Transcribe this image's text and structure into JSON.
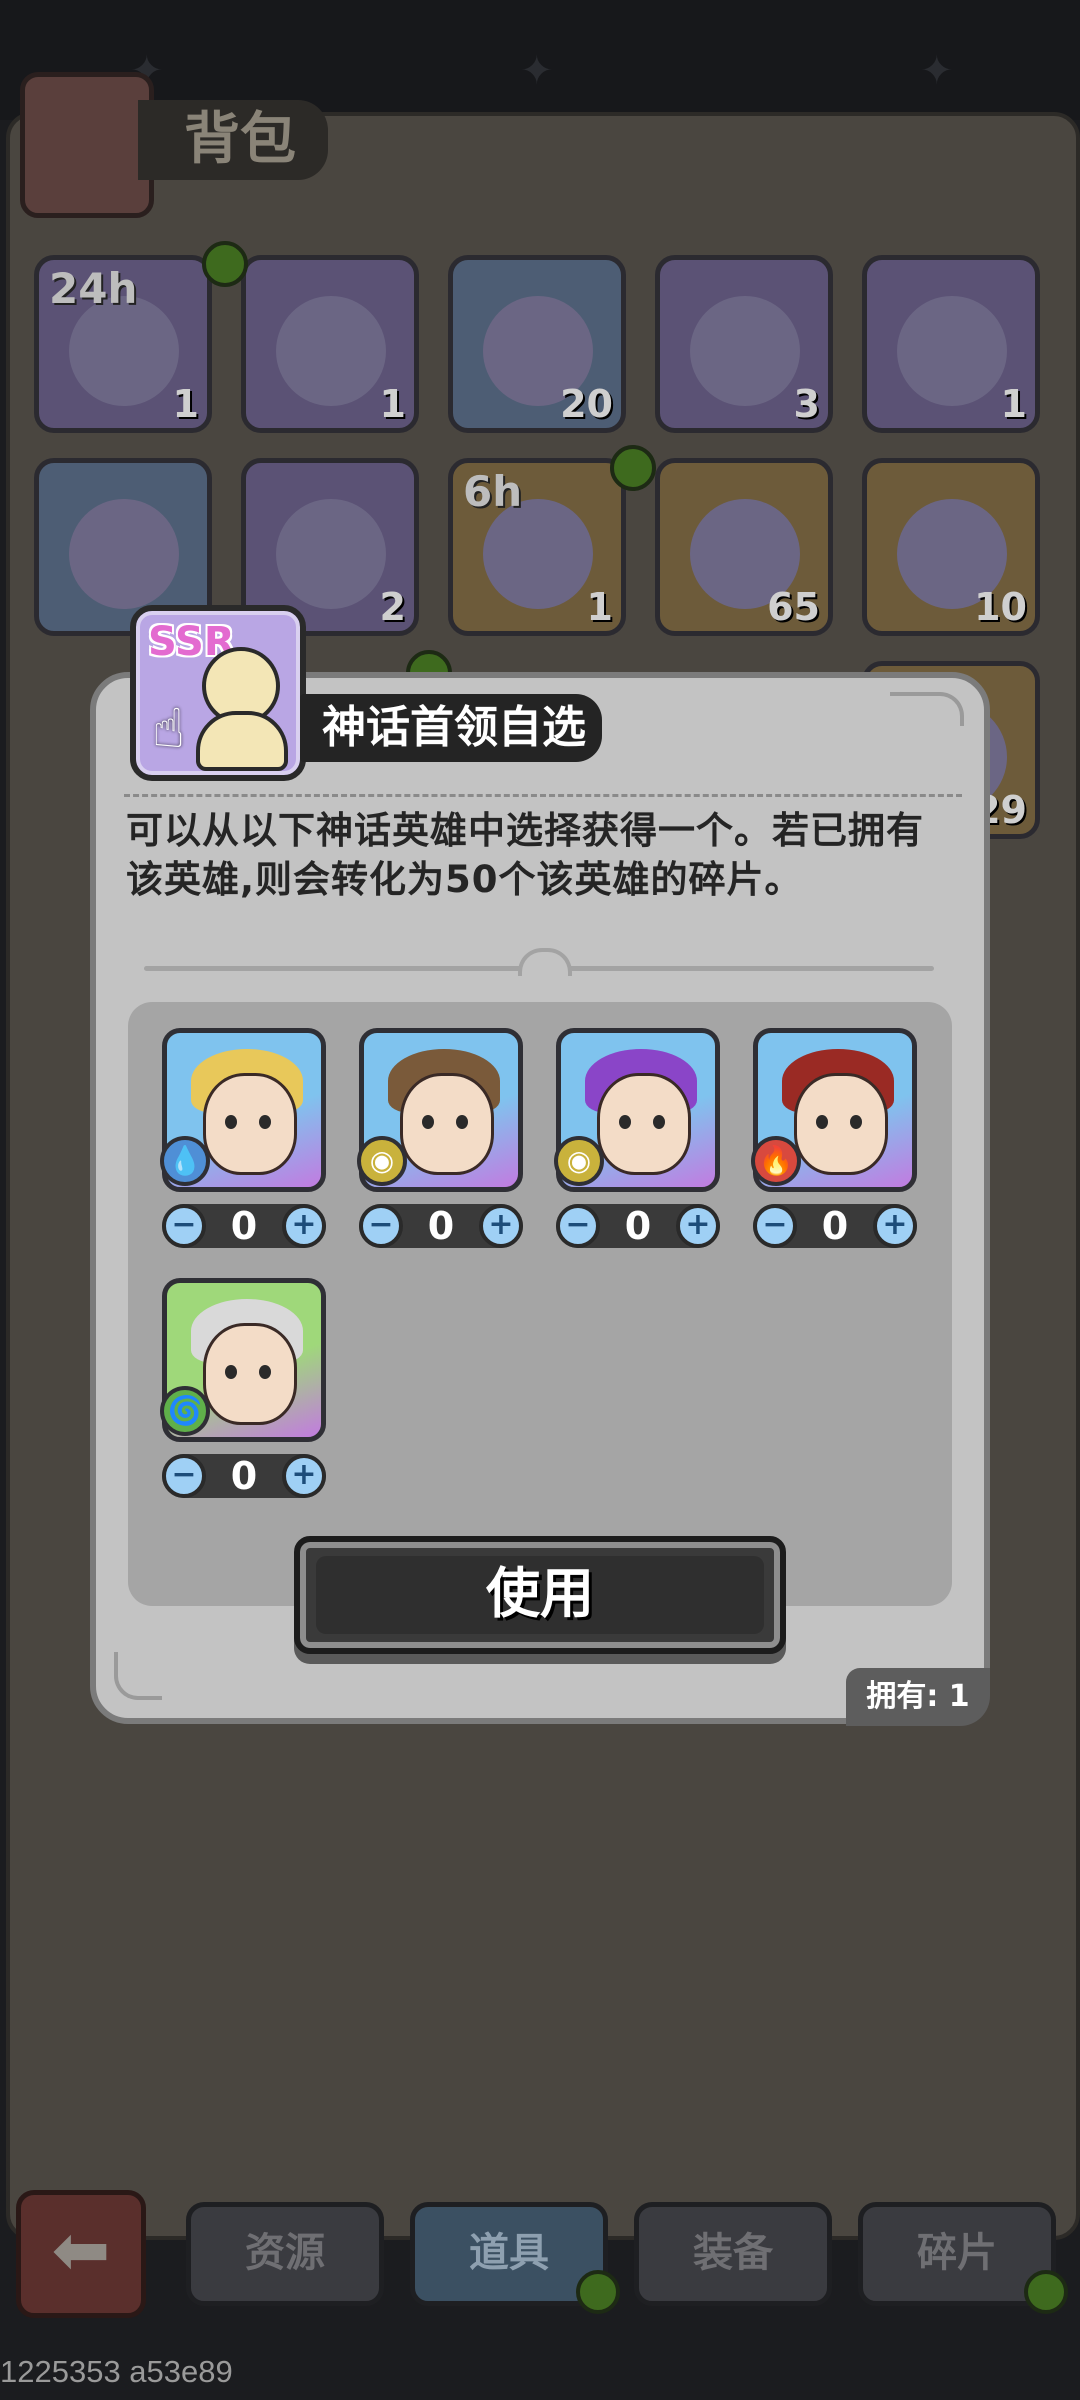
{
  "background": {
    "bag_title": "背包",
    "slots": [
      {
        "tag": "24h",
        "count": "1",
        "style": "purple"
      },
      {
        "tag": "",
        "count": "1",
        "style": "purple"
      },
      {
        "tag": "",
        "count": "20",
        "style": "blue"
      },
      {
        "tag": "",
        "count": "3",
        "style": "purple"
      },
      {
        "tag": "",
        "count": "1",
        "style": "purple"
      },
      {
        "tag": "",
        "count": "",
        "style": "blue"
      },
      {
        "tag": "",
        "count": "2",
        "style": "purple"
      },
      {
        "tag": "6h",
        "count": "1",
        "style": "gold"
      },
      {
        "tag": "",
        "count": "65",
        "style": "gold"
      },
      {
        "tag": "",
        "count": "10",
        "style": "gold"
      },
      {
        "tag": "",
        "count": "29",
        "style": "gold"
      }
    ],
    "nav": {
      "tabs": [
        "资源",
        "道具",
        "装备",
        "碎片"
      ],
      "active": "道具"
    }
  },
  "modal": {
    "badge": "SSR",
    "title": "神话首领自选",
    "description": "可以从以下神话英雄中选择获得一个。若已拥有该英雄,则会转化为50个该英雄的碎片。",
    "heroes": [
      {
        "quantity": "0",
        "element": "water-icon",
        "hair": "#e8c85a",
        "bg": "#7fc3ee"
      },
      {
        "quantity": "0",
        "element": "earth-icon",
        "hair": "#7a5a3a",
        "bg": "#7fc3ee"
      },
      {
        "quantity": "0",
        "element": "earth-icon",
        "hair": "#8a45c8",
        "bg": "#7fc3ee"
      },
      {
        "quantity": "0",
        "element": "fire-icon",
        "hair": "#9a2a24",
        "bg": "#7fc3ee"
      },
      {
        "quantity": "0",
        "element": "wind-icon",
        "hair": "#d9d9d9",
        "bg": "#9fd87a"
      }
    ],
    "use_label": "使用",
    "owned_label": "拥有:",
    "owned_value": "1"
  },
  "debug_text": "1225353 a53e89",
  "colors": {
    "modal_bg": "#c3c3c3",
    "hero_area_bg": "#a5a5a5",
    "stepper_btn": "#9fd0f5",
    "notify_dot": "#3e6a1e"
  }
}
